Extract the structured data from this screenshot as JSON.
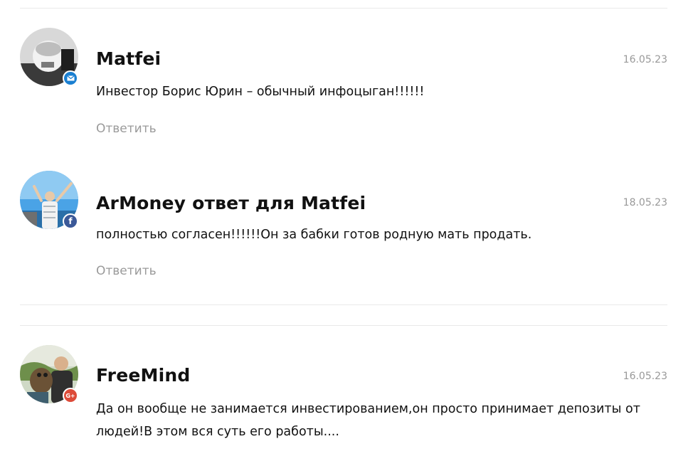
{
  "comments": [
    {
      "author": "Matfei",
      "date": "16.05.23",
      "text": "Инвестор Борис Юрин – обычный инфоцыган!!!!!!",
      "reply_label": "Ответить",
      "source_icon": "email-icon"
    },
    {
      "author": "ArMoney ответ для Matfei",
      "date": "18.05.23",
      "text": "полностью согласен!!!!!!Он за бабки готов родную мать продать.",
      "reply_label": "Ответить",
      "source_icon": "facebook-icon"
    },
    {
      "author": "FreeMind",
      "date": "16.05.23",
      "text": "Да он вообще не занимается инвестированием,он просто принимает депозиты от людей!В этом вся суть его работы....",
      "source_icon": "google-plus-icon"
    }
  ],
  "colors": {
    "email_badge": "#1a7fd1",
    "facebook_badge": "#3b5998",
    "google_plus_badge": "#dd4b39",
    "reply_text": "#9a9a9a",
    "date_text": "#999999"
  }
}
